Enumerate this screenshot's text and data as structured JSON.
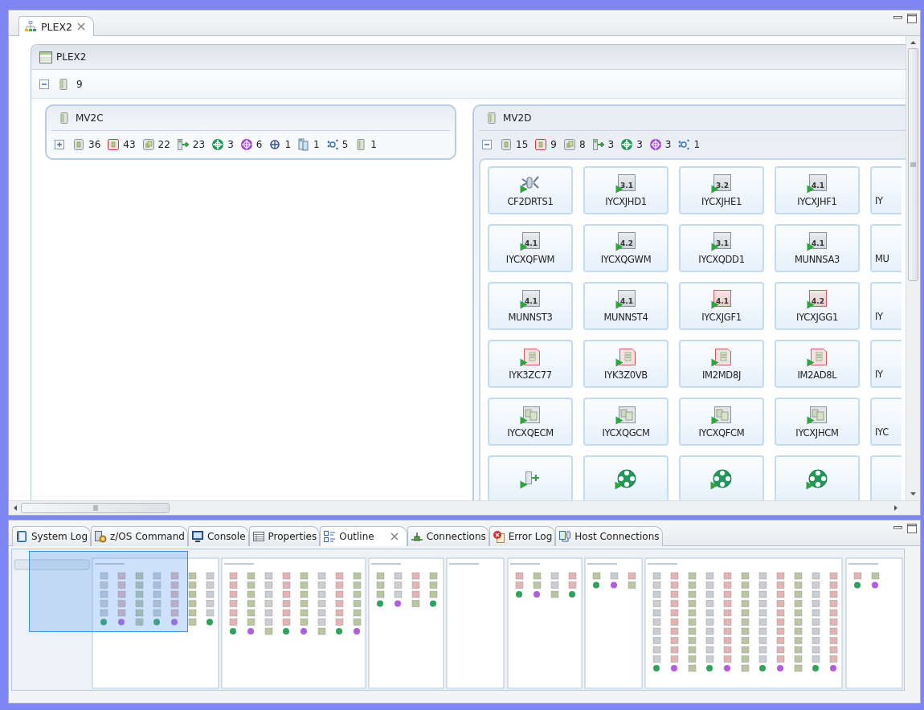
{
  "editor_tabs": [
    {
      "label": "PLEX2",
      "selected": true
    }
  ],
  "plex": {
    "title": "PLEX2",
    "expanded": true,
    "system_count": "9",
    "systems": [
      {
        "name": "MV2C",
        "expanded": false,
        "stats": [
          {
            "kind": "region",
            "count": "36"
          },
          {
            "kind": "region-alert",
            "count": "43"
          },
          {
            "kind": "group",
            "count": "22"
          },
          {
            "kind": "link",
            "count": "23"
          },
          {
            "kind": "net",
            "count": "3"
          },
          {
            "kind": "net-alt",
            "count": "6"
          },
          {
            "kind": "port",
            "count": "1"
          },
          {
            "kind": "stack",
            "count": "1"
          },
          {
            "kind": "cluster",
            "count": "5"
          },
          {
            "kind": "system",
            "count": "1"
          }
        ]
      },
      {
        "name": "MV2D",
        "expanded": true,
        "stats": [
          {
            "kind": "region",
            "count": "15"
          },
          {
            "kind": "region-alert",
            "count": "9"
          },
          {
            "kind": "group",
            "count": "8"
          },
          {
            "kind": "link",
            "count": "3"
          },
          {
            "kind": "net",
            "count": "3"
          },
          {
            "kind": "net-alt",
            "count": "3"
          },
          {
            "kind": "cluster",
            "count": "1"
          }
        ],
        "tiles": [
          {
            "name": "CF2DRTS1",
            "kind": "broken-link",
            "alert": false
          },
          {
            "name": "IYCXJHD1",
            "kind": "version",
            "version": "3.1",
            "alert": false
          },
          {
            "name": "IYCXJHE1",
            "kind": "version",
            "version": "3.2",
            "alert": false
          },
          {
            "name": "IYCXJHF1",
            "kind": "version",
            "version": "4.1",
            "alert": false
          },
          {
            "name": "IY",
            "clipped": true
          },
          {
            "name": "IYCXQFWM",
            "kind": "version",
            "version": "4.1",
            "alert": false
          },
          {
            "name": "IYCXQGWM",
            "kind": "version",
            "version": "4.2",
            "alert": false
          },
          {
            "name": "IYCXQDD1",
            "kind": "version",
            "version": "3.1",
            "alert": false
          },
          {
            "name": "MUNNSA3",
            "kind": "version",
            "version": "4.1",
            "alert": false
          },
          {
            "name": "MU",
            "clipped": true
          },
          {
            "name": "MUNNST3",
            "kind": "version",
            "version": "4.1",
            "alert": false
          },
          {
            "name": "MUNNST4",
            "kind": "version",
            "version": "4.1",
            "alert": false
          },
          {
            "name": "IYCXJGF1",
            "kind": "version",
            "version": "4.1",
            "alert": true
          },
          {
            "name": "IYCXJGG1",
            "kind": "version",
            "version": "4.2",
            "alert": true
          },
          {
            "name": "IY",
            "clipped": true
          },
          {
            "name": "IYK3ZC77",
            "kind": "doc",
            "alert": true
          },
          {
            "name": "IYK3Z0VB",
            "kind": "doc",
            "alert": true
          },
          {
            "name": "IM2MD8J",
            "kind": "doc",
            "alert": true
          },
          {
            "name": "IM2AD8L",
            "kind": "doc",
            "alert": true
          },
          {
            "name": "IY",
            "clipped": true
          },
          {
            "name": "IYCXQECM",
            "kind": "multi",
            "alert": false
          },
          {
            "name": "IYCXQGCM",
            "kind": "multi",
            "alert": false
          },
          {
            "name": "IYCXQFCM",
            "kind": "multi",
            "alert": false
          },
          {
            "name": "IYCXJHCM",
            "kind": "multi",
            "alert": false
          },
          {
            "name": "IYC",
            "clipped": true
          },
          {
            "kind": "connector",
            "alert": false
          },
          {
            "kind": "globe",
            "alert": false
          },
          {
            "kind": "globe",
            "alert": false
          },
          {
            "kind": "globe",
            "alert": false
          },
          {
            "clipped": true
          }
        ]
      }
    ]
  },
  "view_tabs": [
    {
      "label": "System Log",
      "kind": "log",
      "selected": false
    },
    {
      "label": "z/OS Command",
      "kind": "command",
      "selected": false
    },
    {
      "label": "Console",
      "kind": "console",
      "selected": false
    },
    {
      "label": "Properties",
      "kind": "properties",
      "selected": false
    },
    {
      "label": "Outline",
      "kind": "outline",
      "selected": true
    },
    {
      "label": "Connections",
      "kind": "connections",
      "selected": false
    },
    {
      "label": "Error Log",
      "kind": "error",
      "selected": false
    },
    {
      "label": "Host Connections",
      "kind": "host",
      "selected": false
    }
  ]
}
